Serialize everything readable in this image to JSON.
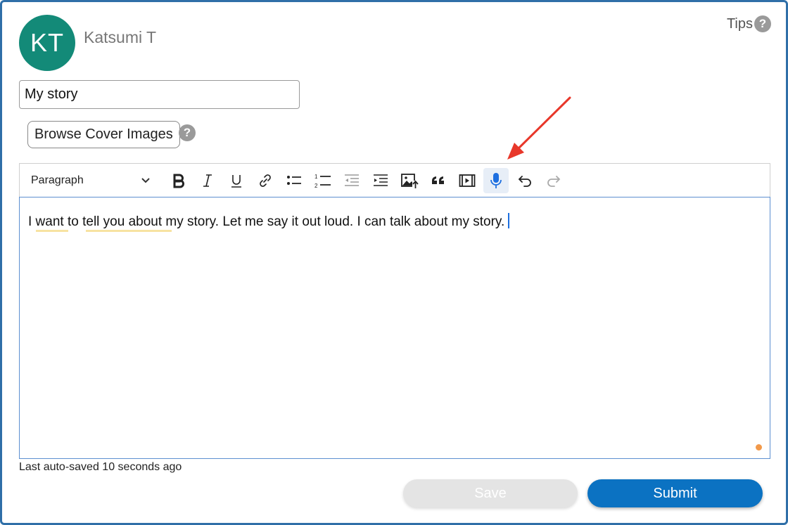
{
  "user": {
    "initials": "KT",
    "name": "Katsumi T"
  },
  "tips": {
    "label": "Tips",
    "icon": "question-circle-icon"
  },
  "story": {
    "title_value": "My story"
  },
  "cover": {
    "browse_label": "Browse Cover Images",
    "help_icon": "question-circle-icon"
  },
  "toolbar": {
    "block_format": "Paragraph",
    "buttons": [
      {
        "name": "bold",
        "icon": "bold-icon"
      },
      {
        "name": "italic",
        "icon": "italic-icon"
      },
      {
        "name": "underline",
        "icon": "underline-icon"
      },
      {
        "name": "link",
        "icon": "link-icon"
      },
      {
        "name": "bulleted-list",
        "icon": "bulleted-list-icon"
      },
      {
        "name": "numbered-list",
        "icon": "numbered-list-icon"
      },
      {
        "name": "outdent",
        "icon": "outdent-icon"
      },
      {
        "name": "indent",
        "icon": "indent-icon"
      },
      {
        "name": "insert-image",
        "icon": "image-upload-icon"
      },
      {
        "name": "block-quote",
        "icon": "quote-icon"
      },
      {
        "name": "insert-media",
        "icon": "media-icon"
      },
      {
        "name": "dictation",
        "icon": "microphone-icon",
        "active": true
      },
      {
        "name": "undo",
        "icon": "undo-icon"
      },
      {
        "name": "redo",
        "icon": "redo-icon",
        "disabled": true
      }
    ]
  },
  "editor": {
    "content": "I want to tell you about my story. Let me say it out loud. I can talk about my story."
  },
  "footer": {
    "autosave_text": "Last auto-saved 10 seconds ago",
    "save_label": "Save",
    "submit_label": "Submit"
  },
  "colors": {
    "avatar": "#138a78",
    "submit": "#0b72c2",
    "annotation_arrow": "#e8372a",
    "active_tool": "#1d6fe0"
  }
}
